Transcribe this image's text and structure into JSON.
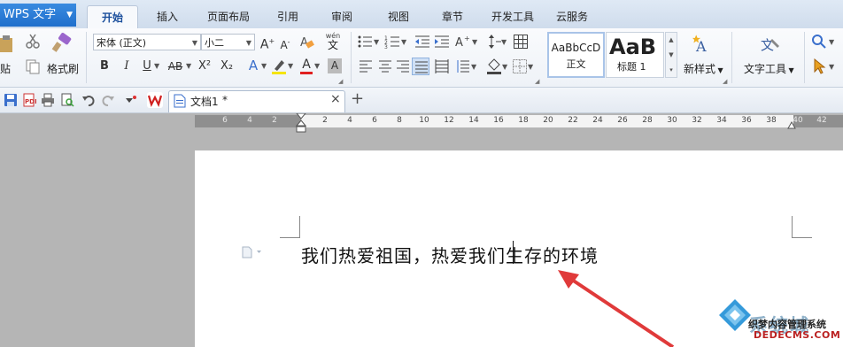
{
  "app": {
    "title": "WPS 文字"
  },
  "menu": {
    "tabs": [
      "开始",
      "插入",
      "页面布局",
      "引用",
      "审阅",
      "视图",
      "章节",
      "开发工具",
      "云服务"
    ],
    "active_tab": "开始"
  },
  "ribbon": {
    "paste_label": "贴",
    "format_painter_label": "格式刷",
    "font_name": "宋体 (正文)",
    "font_size": "小二",
    "grow_font": "A",
    "shrink_font": "A",
    "phonetic_label": "wén",
    "phonetic_char": "文",
    "bold": "B",
    "italic": "I",
    "underline": "U",
    "strikethrough": "AB",
    "superscript": "X²",
    "subscript": "X₂",
    "text_effect": "A",
    "font_color": "A",
    "char_shading": "A",
    "styles": [
      {
        "preview": "AaBbCcD",
        "name": "正文"
      },
      {
        "preview": "AaB",
        "name": "标题 1"
      }
    ],
    "new_style_label": "新样式",
    "text_tools_label": "文字工具"
  },
  "quickbar": {
    "document_tab": {
      "name": "文档1",
      "modified_mark": "*"
    },
    "close_symbol": "×",
    "new_tab_symbol": "+"
  },
  "ruler": {
    "left_labels": [
      "6",
      "4",
      "2"
    ],
    "main_labels": [
      "2",
      "4",
      "6",
      "8",
      "10",
      "12",
      "14",
      "16",
      "18",
      "20",
      "22",
      "24",
      "26",
      "28",
      "30",
      "32",
      "34",
      "36",
      "38"
    ],
    "right_labels": [
      "40",
      "42"
    ]
  },
  "document": {
    "text_before_caret": "我们热爱祖国，热爱我",
    "text_after_caret": "们生存的环境"
  },
  "watermark": {
    "brand": "系统城",
    "site_cn": "织梦内容管理系统",
    "site_en": "DEDECMS.COM"
  },
  "colors": {
    "accent": "#1f6fcc",
    "arrow": "#e03a3a",
    "ruler_dark": "#8f8f8f",
    "workspace": "#b5b5b5"
  }
}
